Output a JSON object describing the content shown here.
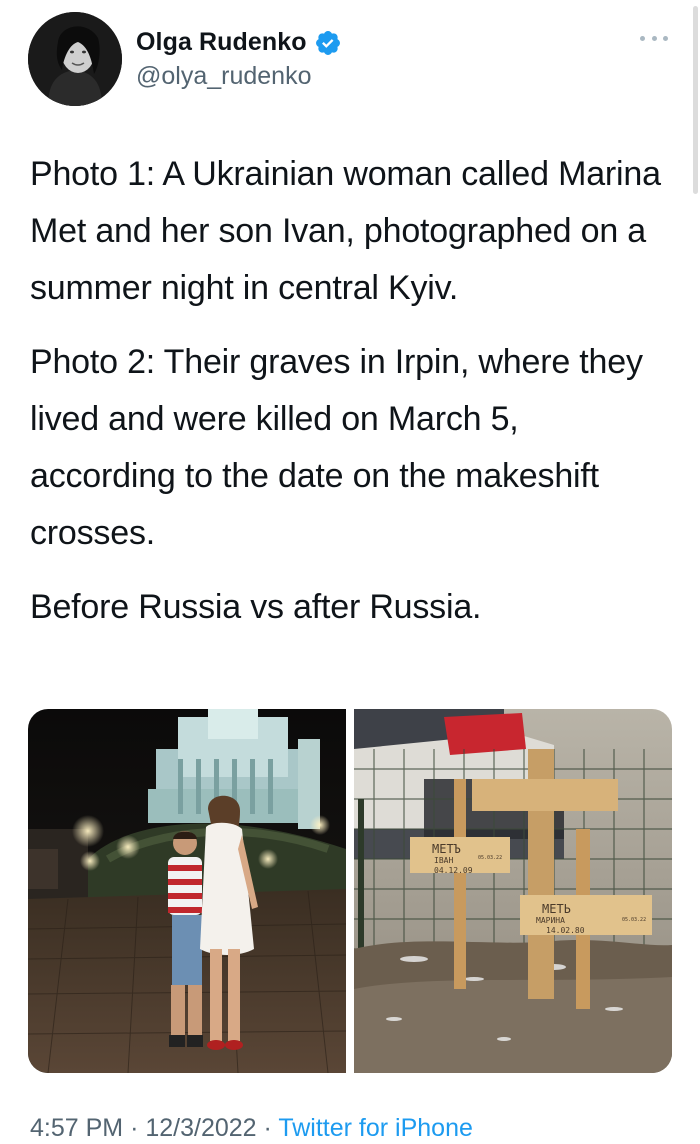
{
  "author": {
    "display_name": "Olga Rudenko",
    "handle": "@olya_rudenko",
    "verified": true
  },
  "tweet": {
    "paragraphs": [
      "Photo 1: A Ukrainian woman called Marina Met and her son Ivan, photographed on a summer night in central Kyiv.",
      "Photo 2: Their graves in Irpin, where they lived and were killed on March 5, according to the date on the makeshift crosses.",
      "Before Russia vs after Russia."
    ]
  },
  "photos": {
    "photo2": {
      "plaque_ivan": [
        "МЕТЪ",
        "ІВАН",
        "04.12.09",
        "05.03.22"
      ],
      "plaque_marina": [
        "МЕТЬ",
        "МАРИНА",
        "14.02.80",
        "05.03.22"
      ]
    }
  },
  "meta": {
    "time": "4:57 PM",
    "separator": "·",
    "date": "12/3/2022",
    "source": "Twitter for iPhone"
  },
  "icons": {
    "verified": "verified-badge-icon",
    "more": "more-options-icon"
  },
  "colors": {
    "accent": "#1d9bf0",
    "secondary_text": "#536471",
    "primary_text": "#0f1419"
  }
}
